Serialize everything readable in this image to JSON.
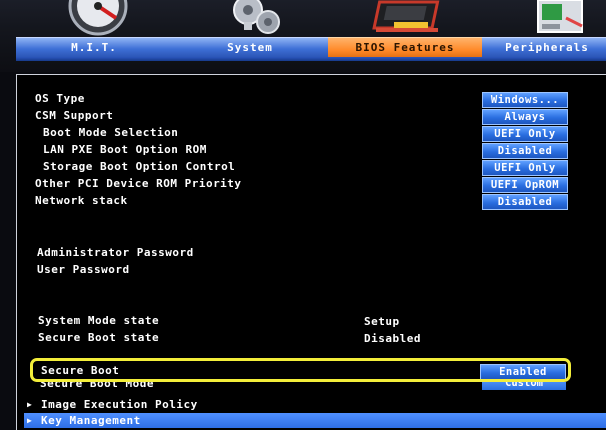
{
  "tabs": [
    {
      "label": "M.I.T.",
      "icon": "gauge-icon"
    },
    {
      "label": "System",
      "icon": "gears-icon"
    },
    {
      "label": "BIOS Features",
      "icon": "chip-icon",
      "active": true
    },
    {
      "label": "Peripherals",
      "icon": "card-icon"
    }
  ],
  "settings": [
    {
      "label": "OS Type",
      "value": "Windows..."
    },
    {
      "label": "CSM Support",
      "value": "Always"
    },
    {
      "label": "Boot Mode Selection",
      "value": "UEFI Only"
    },
    {
      "label": "LAN PXE Boot Option ROM",
      "value": "Disabled"
    },
    {
      "label": "Storage Boot Option Control",
      "value": "UEFI Only"
    },
    {
      "label": "Other PCI Device ROM Priority",
      "value": "UEFI OpROM"
    },
    {
      "label": "Network stack",
      "value": "Disabled"
    }
  ],
  "passwords": [
    {
      "label": "Administrator Password"
    },
    {
      "label": "User Password"
    }
  ],
  "states": [
    {
      "label": "System Mode state",
      "value": "Setup"
    },
    {
      "label": "Secure Boot state",
      "value": "Disabled"
    }
  ],
  "secure_boot": {
    "label": "Secure Boot",
    "value": "Enabled"
  },
  "secure_boot_mode": {
    "label": "Secure Boot Mode",
    "value": "Custom"
  },
  "submenus": [
    {
      "label": "Image Execution Policy"
    },
    {
      "label": "Key Management"
    }
  ],
  "colors": {
    "tab_blue": "#3d6fd6",
    "tab_active_orange": "#ff8a2a",
    "value_button_blue": "#2a6ee0",
    "highlight_yellow": "#f3ee3a",
    "background": "#000000"
  }
}
